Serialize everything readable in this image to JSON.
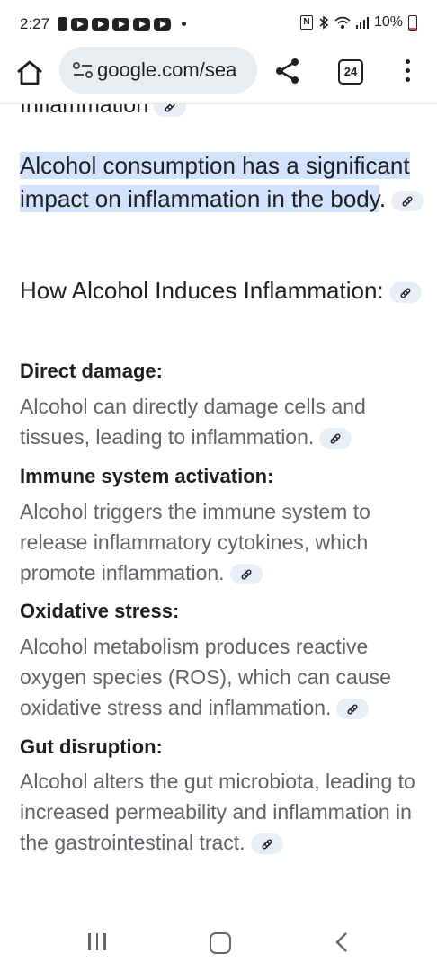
{
  "status_bar": {
    "time": "2:27",
    "battery": "10%"
  },
  "toolbar": {
    "url": "google.com/sea",
    "tab_count": "24"
  },
  "content": {
    "partial_heading": "Inflammation",
    "lead_highlight": "Alcohol consumption has a significant impact on inflammation in the body",
    "lead_end": ".",
    "section_heading": "How Alcohol Induces Inflammation:",
    "items": [
      {
        "title": "Direct damage:",
        "text": "Alcohol can directly damage cells and tissues, leading to inflammation."
      },
      {
        "title": "Immune system activation:",
        "text": "Alcohol triggers the immune system to release inflammatory cytokines, which promote inflammation."
      },
      {
        "title": "Oxidative stress:",
        "text": "Alcohol metabolism produces reactive oxygen species (ROS), which can cause oxidative stress and inflammation."
      },
      {
        "title": "Gut disruption:",
        "text": "Alcohol alters the gut microbiota, leading to increased permeability and inflammation in the gastrointestinal tract."
      }
    ]
  },
  "colors": {
    "highlight": "#d3e3fd",
    "url_bar_bg": "#e8edf2",
    "body_text": "#5f6368"
  }
}
